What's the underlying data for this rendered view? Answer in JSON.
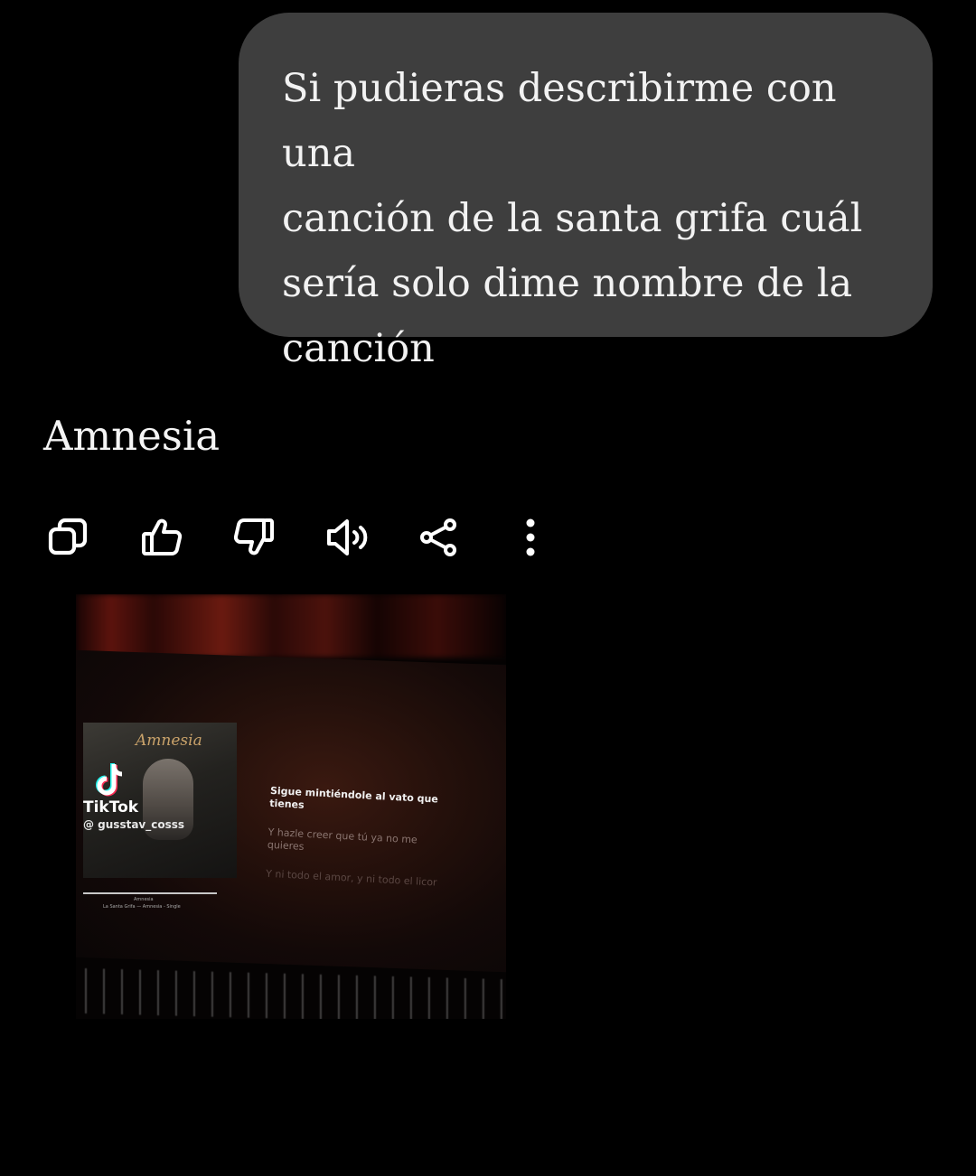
{
  "conversation": {
    "user_message": "Si pudieras describirme con una\ncanción de la santa grifa cuál\nsería solo dime nombre de la\ncanción",
    "assistant_reply": "Amnesia"
  },
  "actions": {
    "icons": [
      "copy-icon",
      "thumbs-up-icon",
      "thumbs-down-icon",
      "read-aloud-icon",
      "share-icon",
      "more-vertical-icon"
    ]
  },
  "media": {
    "album_title": "Amnesia",
    "watermark_brand": "TikTok",
    "watermark_user": "@ gusstav_cosss",
    "track_title": "Amnesia",
    "track_subtitle": "La Santa Grifa — Amnesia - Single",
    "lyrics": [
      "Sigue mintiéndole al vato que tienes",
      "Y hazle creer que tú ya no me quieres",
      "Y ni todo el amor, y ni todo el licor"
    ]
  },
  "colors": {
    "background": "#000000",
    "bubble": "#3e3e3e",
    "text": "#f2f2f2",
    "icon": "#ffffff"
  }
}
